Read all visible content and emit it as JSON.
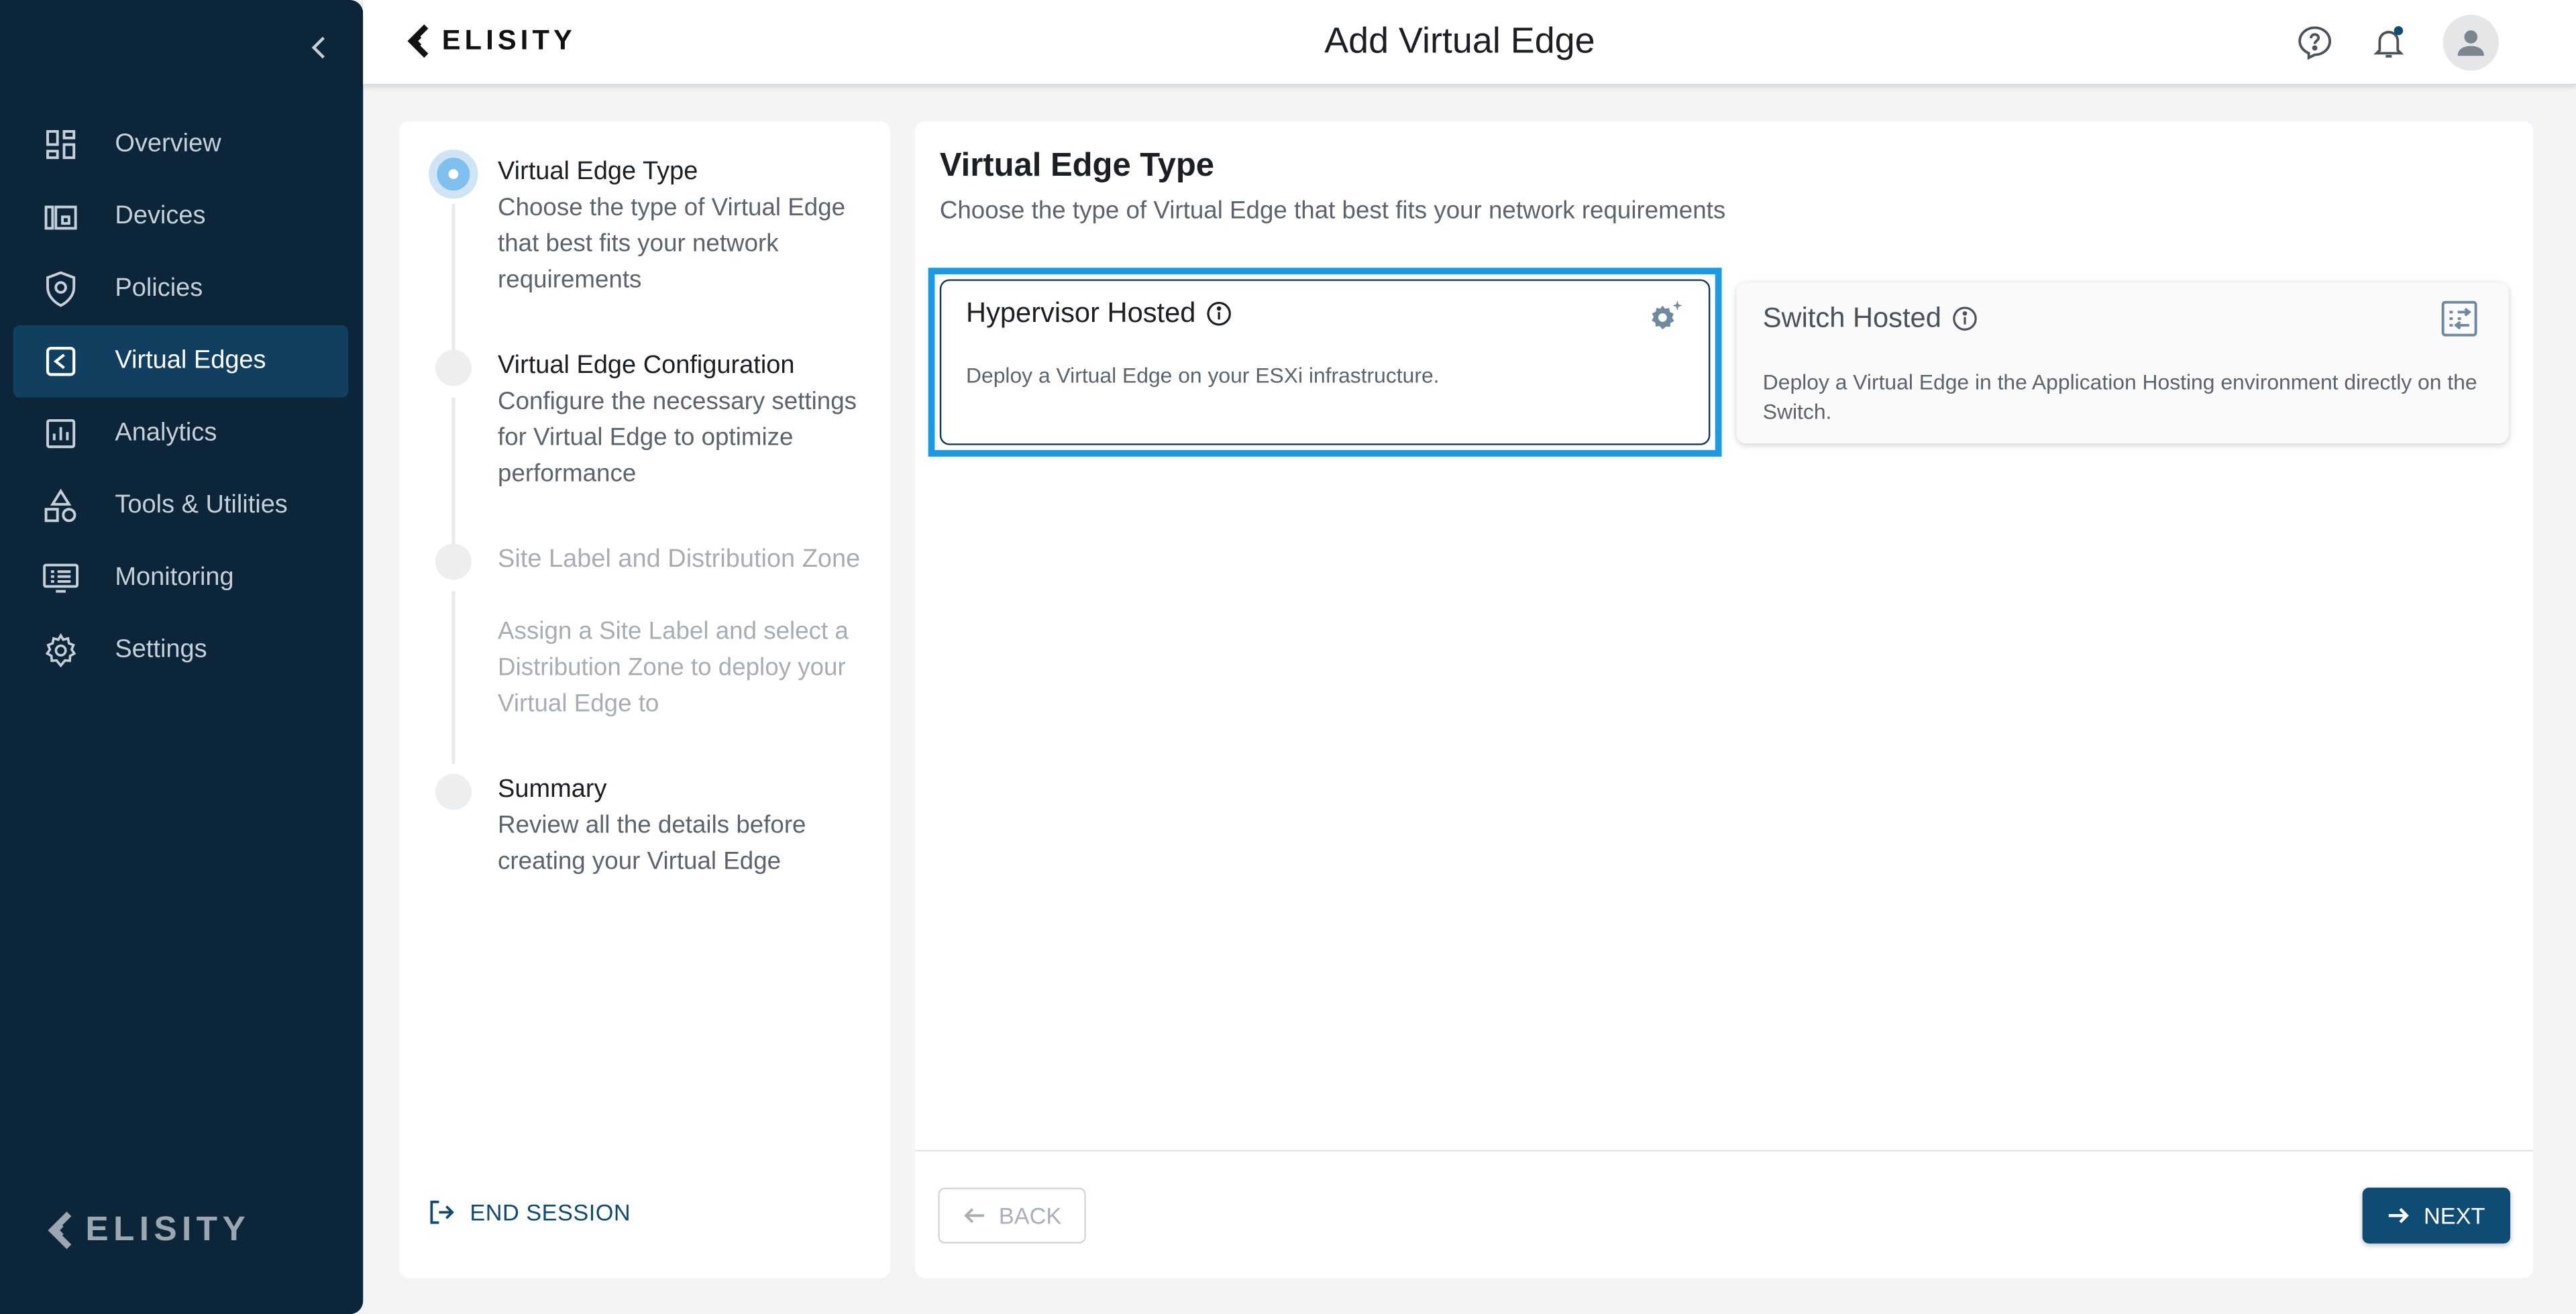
{
  "app": {
    "brand": "ELISITY",
    "page_title": "Add Virtual Edge"
  },
  "sidebar": {
    "items": [
      {
        "label": "Overview",
        "icon": "overview-icon",
        "active": false
      },
      {
        "label": "Devices",
        "icon": "devices-icon",
        "active": false
      },
      {
        "label": "Policies",
        "icon": "policies-shield-icon",
        "active": false
      },
      {
        "label": "Virtual Edges",
        "icon": "virtual-edges-icon",
        "active": true
      },
      {
        "label": "Analytics",
        "icon": "analytics-icon",
        "active": false
      },
      {
        "label": "Tools & Utilities",
        "icon": "tools-icon",
        "active": false
      },
      {
        "label": "Monitoring",
        "icon": "monitoring-icon",
        "active": false
      },
      {
        "label": "Settings",
        "icon": "gear-icon",
        "active": false
      }
    ],
    "footer_logo": "ELISITY"
  },
  "stepper": {
    "steps": [
      {
        "title": "Virtual Edge Type",
        "description": "Choose the type of Virtual Edge that best fits your network requirements",
        "state": "active"
      },
      {
        "title": "Virtual Edge Configuration",
        "description": "Configure the necessary settings for Virtual Edge to optimize performance",
        "state": "pending"
      },
      {
        "title": "Site Label and Distribution Zone",
        "description": "Assign a Site Label and select a Distribution Zone to deploy your Virtual Edge to",
        "state": "disabled"
      },
      {
        "title": "Summary",
        "description": "Review all the details before creating your Virtual Edge",
        "state": "pending"
      }
    ],
    "end_session_label": "END SESSION"
  },
  "main": {
    "title": "Virtual Edge Type",
    "subtitle": "Choose the type of Virtual Edge that best fits your network requirements",
    "options": [
      {
        "title": "Hypervisor Hosted",
        "description": "Deploy a Virtual Edge on your ESXi infrastructure.",
        "selected": true,
        "icon": "gear-sparkle-icon"
      },
      {
        "title": "Switch Hosted",
        "description": "Deploy a Virtual Edge in the Application Hosting environment directly on the Switch.",
        "selected": false,
        "icon": "switch-icon"
      }
    ],
    "back_label": "BACK",
    "next_label": "NEXT"
  },
  "colors": {
    "sidebar_bg": "#0c2538",
    "sidebar_active": "#113f5f",
    "primary": "#0f4c74",
    "selection_outline": "#1a9be8",
    "notification_dot": "#0f4c74"
  }
}
